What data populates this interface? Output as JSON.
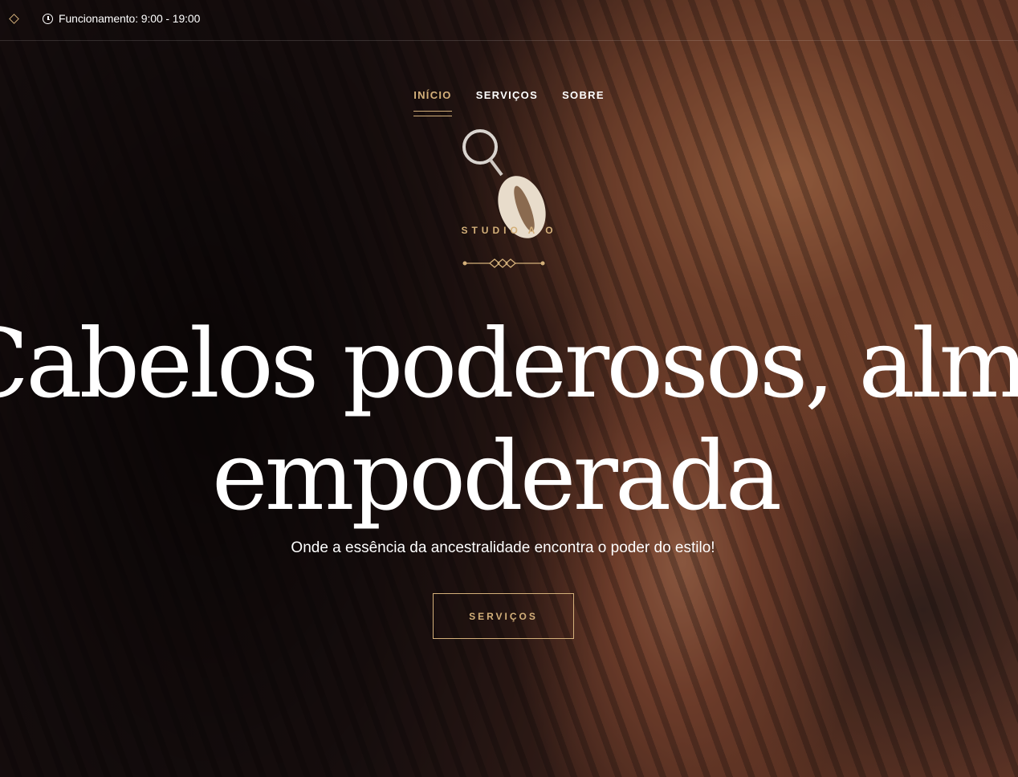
{
  "topbar": {
    "hours_label": "Funcionamento: 9:00 - 19:00"
  },
  "nav": {
    "items": [
      {
        "label": "INÍCIO",
        "active": true
      },
      {
        "label": "SERVIÇOS",
        "active": false
      },
      {
        "label": "SOBRE",
        "active": false
      }
    ]
  },
  "hero": {
    "brand": "STUDIO A    O",
    "headline_line1": "Cabelos poderosos, alma",
    "headline_line2": "empoderada",
    "subtitle": "Onde a essência da ancestralidade encontra o poder do estilo!",
    "cta_label": "SERVIÇOS"
  },
  "colors": {
    "accent": "#d4b07a",
    "text": "#ffffff"
  },
  "icons": [
    "diamond-icon",
    "clock-icon"
  ]
}
